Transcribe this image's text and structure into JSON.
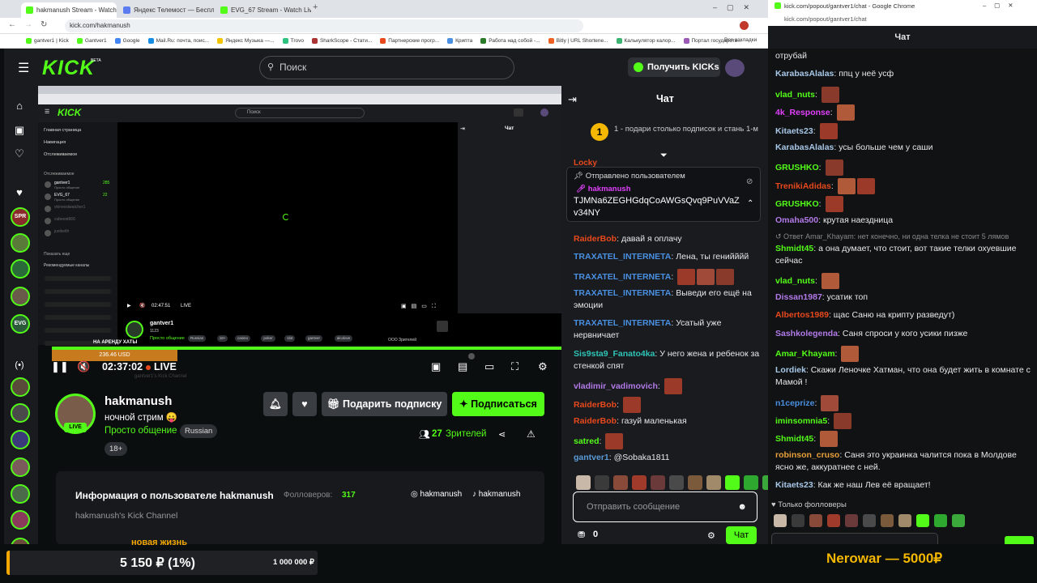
{
  "browser": {
    "tabs": [
      {
        "label": "hakmanush Stream - Watch Li..."
      },
      {
        "label": "Яндекс Телемост — Беспл..."
      },
      {
        "label": "EVG_67 Stream - Watch Live on..."
      }
    ],
    "new_tab": "+",
    "url": "kick.com/hakmanush",
    "bookmarks": [
      "gantver1 | Kick",
      "Gantver1",
      "Google",
      "Mail.Ru: почта, поис...",
      "Яндекс Музыка —...",
      "Trovo",
      "SharkScope - Стати...",
      "Партнерские прогр...",
      "Крипта",
      "Работа над собой -...",
      "Bitly | URL Shortene...",
      "Калькулятор калор...",
      "Портал государств..."
    ],
    "all_bookmarks": "Все закладки"
  },
  "header": {
    "logo": "KICK",
    "logo_badge": "BETA",
    "search_placeholder": "Поиск",
    "get_kicks": "Получить KICKs"
  },
  "sidebar": {
    "channels": [
      "SPR",
      "",
      "",
      "",
      "EVG",
      "",
      "",
      "",
      "",
      "",
      "",
      ""
    ]
  },
  "inner_stream": {
    "logo": "KICK",
    "search": "Поиск",
    "chat": "Чат",
    "nav": [
      "Главная страница",
      "Навигация",
      "Отслеживаемое"
    ],
    "followed_title": "Отслеживаемое",
    "followed": [
      {
        "name": "gantver1",
        "sub": "Просто общение",
        "count": "285"
      },
      {
        "name": "EVG_67",
        "sub": "Просто общение",
        "count": "22"
      },
      {
        "name": "vkinvestwatcher1",
        "sub": "",
        "count": ""
      },
      {
        "name": "cubeest666",
        "sub": "",
        "count": ""
      },
      {
        "name": "justkeith",
        "sub": "",
        "count": ""
      }
    ],
    "show_more": "Показать еще",
    "recommended_title": "Рекомендуемые каналы",
    "time": "02:47:51",
    "live": "LIVE",
    "streamer": "gantver1",
    "streamer_sub": "1123",
    "category": "Просто общение",
    "tags": [
      "Russian",
      "18+",
      "casino",
      "poker",
      "slot",
      "gantver",
      "alcolove"
    ],
    "viewers": "ООО Зрителей",
    "banner": "НА АРЕНДУ ХАТЫ"
  },
  "player": {
    "tooltip": "236.46 USD",
    "time": "02:37:02",
    "live": "LIVE",
    "ghost": "gantver1's Kick Channel"
  },
  "streamer": {
    "name": "hakmanush",
    "title": "ночной стрим 😛",
    "category": "Просто общение",
    "language": "Russian",
    "age": "18+",
    "live": "LIVE",
    "gift_sub": "Подарить подписку",
    "subscribe": "Подписаться",
    "viewers_count": "27",
    "viewers_label": "Зрителей"
  },
  "about": {
    "title": "Информация о пользователе hakmanush",
    "followers_label": "Фолловеров:",
    "followers": "317",
    "instagram": "hakmanush",
    "tiktok": "hakmanush",
    "description": "hakmanush's Kick Channel",
    "ghost_below": "новая жизнь"
  },
  "chat_left": {
    "title": "Чат",
    "gift_goal_num": "1",
    "gift_goal_text": "1 - подари столько подписок и стань 1-м",
    "pinned_by": "Отправлено пользователем",
    "pinned_user": "hakmanush",
    "pinned_text": "TJMNa6ZEGHGdqCoAWGsQvq9PuVVaZv34NY",
    "partial_user": "Locky",
    "messages": [
      {
        "user": "RaiderBob",
        "color": "#e8491c",
        "text": "давай я оплачу"
      },
      {
        "user": "TRAXATEL_INTERNETA",
        "color": "#4a90e2",
        "text": "Лена, ты генийййй"
      },
      {
        "user": "TRAXATEL_INTERNETA",
        "color": "#4a90e2",
        "text": ""
      },
      {
        "user": "TRAXATEL_INTERNETA",
        "color": "#4a90e2",
        "text": "Выведи его ещё на эмоции"
      },
      {
        "user": "TRAXATEL_INTERNETA",
        "color": "#4a90e2",
        "text": "Усатый уже нервничает"
      },
      {
        "user": "Sis9sta9_Fanato4ka",
        "color": "#2ec4b6",
        "text": "У него жена и ребенок за стенкой спят"
      },
      {
        "user": "vladimir_vadimovich",
        "color": "#b27ae8",
        "text": ""
      },
      {
        "user": "RaiderBob",
        "color": "#e8491c",
        "text": ""
      },
      {
        "user": "RaiderBob",
        "color": "#e8491c",
        "text": "газуй маленькая"
      },
      {
        "user": "satred",
        "color": "#53fc18",
        "text": ""
      },
      {
        "user": "gantver1",
        "color": "#5b9bd5",
        "text": "@Sobaka1811"
      }
    ],
    "input_placeholder": "Отправить сообщение",
    "points": "0",
    "send": "Чат"
  },
  "chat_right": {
    "window_url": "kick.com/popout/gantver1/chat - Google Chrome",
    "url": "kick.com/popout/gantver1/chat",
    "title": "Чат",
    "messages": [
      {
        "user": "",
        "color": "#e8e8e8",
        "text": "отрубай",
        "reply": ""
      },
      {
        "user": "KarabasAlalas",
        "color": "#a8c8e8",
        "text": "ппц у неё усф",
        "reply": ""
      },
      {
        "user": "vlad_nuts",
        "color": "#53fc18",
        "text": "",
        "reply": ""
      },
      {
        "user": "4k_Response",
        "color": "#e040fb",
        "text": "",
        "reply": ""
      },
      {
        "user": "Kitaets23",
        "color": "#a8c8e8",
        "text": "",
        "reply": ""
      },
      {
        "user": "KarabasAlalas",
        "color": "#a8c8e8",
        "text": "усы больше чем у саши",
        "reply": ""
      },
      {
        "user": "GRUSHKO",
        "color": "#53fc18",
        "text": "",
        "reply": ""
      },
      {
        "user": "TrenikiAdidas",
        "color": "#e8491c",
        "text": "",
        "reply": ""
      },
      {
        "user": "GRUSHKO",
        "color": "#53fc18",
        "text": "",
        "reply": ""
      },
      {
        "user": "Omaha500",
        "color": "#b27ae8",
        "text": "крутая наездница",
        "reply": ""
      },
      {
        "user": "Shmidt45",
        "color": "#53fc18",
        "text": "а она думает, что стоит, вот такие телки охуевшие сейчас",
        "reply": "Ответ Amar_Khayam: нет конечно, ни одна телка не стоит 5 лямов"
      },
      {
        "user": "vlad_nuts",
        "color": "#53fc18",
        "text": "",
        "reply": ""
      },
      {
        "user": "Dissan1987",
        "color": "#b27ae8",
        "text": "усатик топ",
        "reply": ""
      },
      {
        "user": "Albertos1989",
        "color": "#e8491c",
        "text": "щас Саню на крипту разведут)",
        "reply": ""
      },
      {
        "user": "Sashkolegenda",
        "color": "#b27ae8",
        "text": "Саня спроси у кого усики пизже",
        "reply": ""
      },
      {
        "user": "Amar_Khayam",
        "color": "#53fc18",
        "text": "",
        "reply": ""
      },
      {
        "user": "Lordiek",
        "color": "#a8c8e8",
        "text": "Скажи Леночке Хатман, что она будет жить в комнате с Мамой !",
        "reply": ""
      },
      {
        "user": "n1ceprize",
        "color": "#4a90e2",
        "text": "",
        "reply": ""
      },
      {
        "user": "iminsomnia5",
        "color": "#53fc18",
        "text": "",
        "reply": ""
      },
      {
        "user": "Shmidt45",
        "color": "#53fc18",
        "text": "",
        "reply": ""
      },
      {
        "user": "robinson_cruso",
        "color": "#e8a03a",
        "text": "Саня это украинка чалится пока в Молдове ясно же, аккуратнее с ней.",
        "reply": ""
      },
      {
        "user": "Kitaets23",
        "color": "#a8c8e8",
        "text": "Как же наш Лев её вращает!",
        "reply": ""
      }
    ],
    "followers_only": "Только фолловеры"
  },
  "overlay": {
    "progress_text": "5 150 ₽ (1%)",
    "goal": "1 000 000 ₽",
    "progress_fraction": 0.01,
    "donation": "Nerowar — 5000₽"
  }
}
